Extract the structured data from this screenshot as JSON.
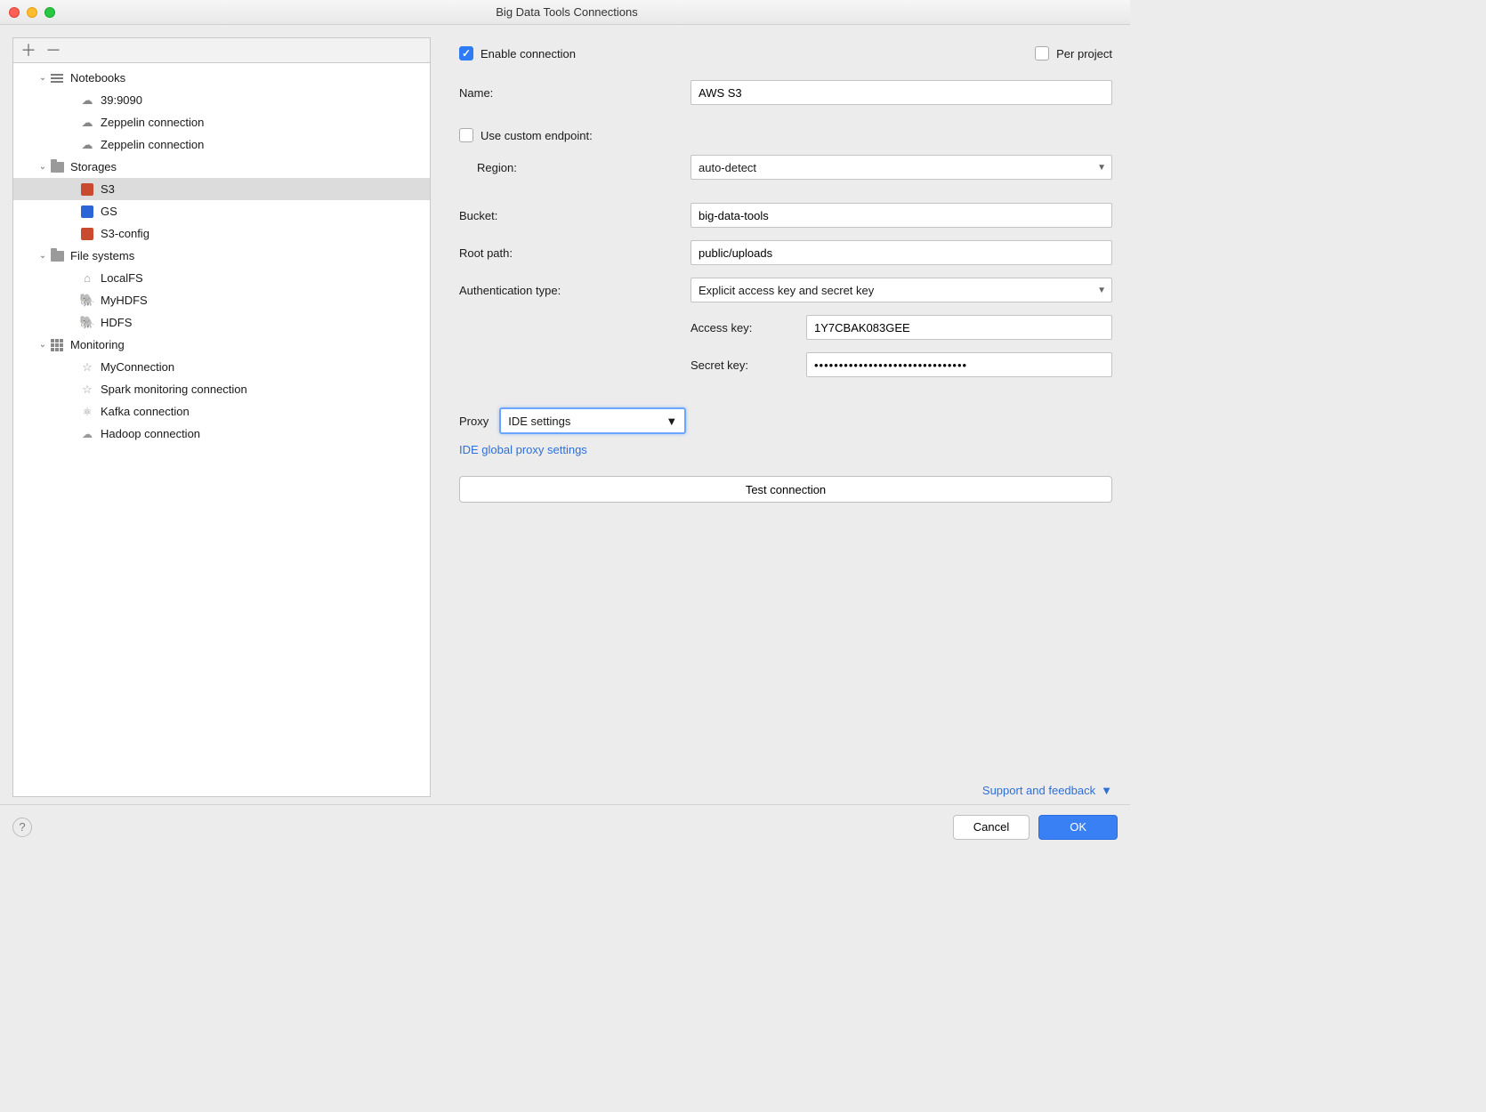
{
  "window": {
    "title": "Big Data Tools Connections"
  },
  "tree": {
    "groups": [
      {
        "label": "Notebooks",
        "icon": "list",
        "items": [
          {
            "label": "39:9090",
            "icon": "cloud"
          },
          {
            "label": "Zeppelin connection",
            "icon": "cloud"
          },
          {
            "label": "Zeppelin connection",
            "icon": "cloud"
          }
        ]
      },
      {
        "label": "Storages",
        "icon": "folder-cloud",
        "items": [
          {
            "label": "S3",
            "icon": "s3",
            "selected": true
          },
          {
            "label": "GS",
            "icon": "gs"
          },
          {
            "label": "S3-config",
            "icon": "s3"
          }
        ]
      },
      {
        "label": "File systems",
        "icon": "folder",
        "items": [
          {
            "label": "LocalFS",
            "icon": "home"
          },
          {
            "label": "MyHDFS",
            "icon": "hdfs"
          },
          {
            "label": "HDFS",
            "icon": "hdfs"
          }
        ]
      },
      {
        "label": "Monitoring",
        "icon": "grid",
        "items": [
          {
            "label": "MyConnection",
            "icon": "star"
          },
          {
            "label": "Spark monitoring connection",
            "icon": "star"
          },
          {
            "label": "Kafka connection",
            "icon": "kafka"
          },
          {
            "label": "Hadoop connection",
            "icon": "hadoop"
          }
        ]
      }
    ]
  },
  "form": {
    "enable_label": "Enable connection",
    "enable_checked": true,
    "per_project_label": "Per project",
    "per_project_checked": false,
    "name_label": "Name:",
    "name_value": "AWS S3",
    "use_custom_endpoint_label": "Use custom endpoint:",
    "use_custom_endpoint_checked": false,
    "region_label": "Region:",
    "region_value": "auto-detect",
    "bucket_label": "Bucket:",
    "bucket_value": "big-data-tools",
    "rootpath_label": "Root path:",
    "rootpath_value": "public/uploads",
    "authtype_label": "Authentication type:",
    "authtype_value": "Explicit access key and secret key",
    "accesskey_label": "Access key:",
    "accesskey_value": "1Y7CBAK083GEE",
    "secretkey_label": "Secret key:",
    "secretkey_value": "•••••••••••••••••••••••••••••••",
    "proxy_label": "Proxy",
    "proxy_value": "IDE settings",
    "proxy_link": "IDE global proxy settings",
    "test_label": "Test connection",
    "support_label": "Support and feedback"
  },
  "footer": {
    "cancel": "Cancel",
    "ok": "OK"
  }
}
